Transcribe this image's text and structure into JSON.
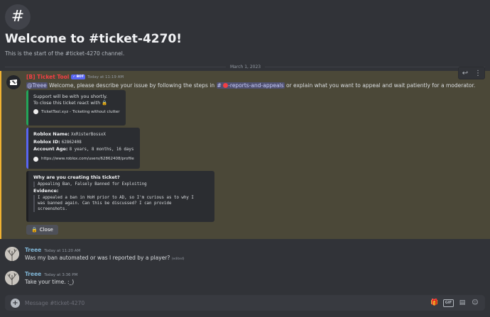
{
  "channel": {
    "icon": "#",
    "welcome": "Welcome to #ticket-4270!",
    "start_text": "This is the start of the #ticket-4270 channel.",
    "date_divider": "March 1, 2023"
  },
  "bot_message": {
    "author": "[B] Ticket Tool",
    "tag": "✓ BOT",
    "timestamp": "Today at 11:19 AM",
    "mention": "@Treee",
    "text_before": " Welcome, please describe your issue by following the steps in ",
    "channel_mention": "-reports-and-appeals",
    "text_after": " or explain what you want to appeal and wait patiently for a moderator.",
    "highlight_color": "#f0b232",
    "embed1": {
      "line1": "Support will be with you shortly.",
      "line2": "To close this ticket react with 🔒",
      "footer": "TicketTool.xyz - Ticketing without clutter"
    },
    "embed2": {
      "name_label": "Roblox Name:",
      "name_value": "XxRisterBossxX",
      "id_label": "Roblox ID:",
      "id_value": "62862408",
      "age_label": "Account Age:",
      "age_value": "8 years, 8 months, 16 days",
      "footer": "https://www.roblox.com/users/62862408/profile"
    },
    "embed3": {
      "q1": "Why are you creating this ticket?",
      "a1": "Appealing Ban, Falsely Banned for Exploiting",
      "q2": "Evidence:",
      "a2_line1": "I appealed a ban in HoH prior to AD, so I'm curious as to why I",
      "a2_line2": "was banned again. Can this be discussed? I can provide",
      "a2_line3": "screenshots."
    },
    "close_button": "Close"
  },
  "messages": [
    {
      "author": "Treee",
      "timestamp": "Today at 11:20 AM",
      "text": "Was my ban automated or was I reported by a player?",
      "edited": "(edited)"
    },
    {
      "author": "Treee",
      "timestamp": "Today at 3:36 PM",
      "text": "Take your time. :_)"
    }
  ],
  "composer": {
    "placeholder": "Message #ticket-4270",
    "gif_label": "GIF"
  }
}
